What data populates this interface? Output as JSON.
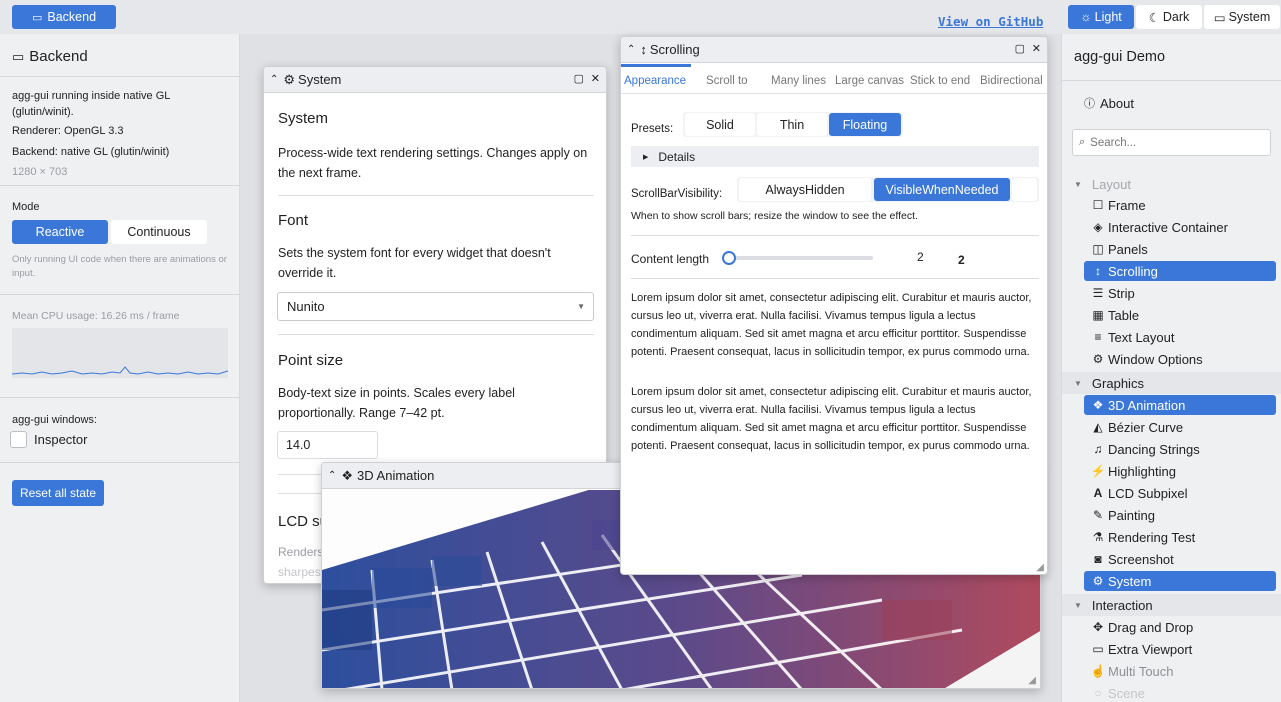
{
  "topbar": {
    "backend_button": "Backend",
    "github_link": "View on GitHub",
    "theme": {
      "light": "Light",
      "dark": "Dark",
      "system": "System"
    }
  },
  "left": {
    "title": "Backend",
    "info1": "agg-gui running inside native GL (glutin/winit).",
    "info2": "Renderer: OpenGL 3.3",
    "info3": "Backend: native GL (glutin/winit)",
    "size": "1280 × 703",
    "mode_label": "Mode",
    "mode_reactive": "Reactive",
    "mode_continuous": "Continuous",
    "mode_hint": "Only running UI code when there are animations or input.",
    "cpu": "Mean CPU usage: 16.26 ms / frame",
    "windows_label": "agg-gui windows:",
    "inspector": "Inspector",
    "reset": "Reset all state"
  },
  "system_window": {
    "title": "System",
    "heading": "System",
    "desc": "Process-wide text rendering settings. Changes apply on the next frame.",
    "font_heading": "Font",
    "font_desc": "Sets the system font for every widget that doesn't override it.",
    "font_value": "Nunito",
    "point_heading": "Point size",
    "point_desc": "Body-text size in points. Scales every label proportionally. Range 7–42 pt.",
    "point_value": "14.0",
    "lcd_heading": "LCD su",
    "lcd_desc1": "Renders",
    "lcd_desc2": "sharpes"
  },
  "anim_window": {
    "title": "3D Animation"
  },
  "scroll_window": {
    "title": "Scrolling",
    "tabs": [
      "Appearance",
      "Scroll to",
      "Many lines",
      "Large canvas",
      "Stick to end",
      "Bidirectional"
    ],
    "presets_label": "Presets:",
    "presets": [
      "Solid",
      "Thin",
      "Floating"
    ],
    "details": "Details",
    "visibility_label": "ScrollBarVisibility:",
    "visibility": [
      "AlwaysHidden",
      "VisibleWhenNeeded"
    ],
    "visibility_hint": "When to show scroll bars; resize the window to see the effect.",
    "content_label": "Content length",
    "content_value1": "2",
    "content_value2": "2",
    "slider_level": 0,
    "lorem": "Lorem ipsum dolor sit amet, consectetur adipiscing elit. Curabitur et mauris auctor, cursus leo ut, viverra erat. Nulla facilisi. Vivamus tempus ligula a lectus condimentum aliquam. Sed sit amet magna et arcu efficitur porttitor. Suspendisse potenti. Praesent consequat, lacus in sollicitudin tempor, ex purus commodo urna."
  },
  "right": {
    "title": "agg-gui Demo",
    "about": "About",
    "search_placeholder": "Search...",
    "cat_layout": "Layout",
    "layout_items": [
      "Frame",
      "Interactive Container",
      "Panels",
      "Scrolling",
      "Strip",
      "Table",
      "Text Layout",
      "Window Options"
    ],
    "cat_graphics": "Graphics",
    "graphics_items": [
      "3D Animation",
      "Bézier Curve",
      "Dancing Strings",
      "Highlighting",
      "LCD Subpixel",
      "Painting",
      "Rendering Test",
      "Screenshot",
      "System"
    ],
    "cat_interaction": "Interaction",
    "interaction_items": [
      "Drag and Drop",
      "Extra Viewport",
      "Multi Touch",
      "Scene"
    ]
  },
  "colors": {
    "accent": "#3a77d9",
    "background": "#e6e7ea",
    "panel": "#eff0f2"
  }
}
